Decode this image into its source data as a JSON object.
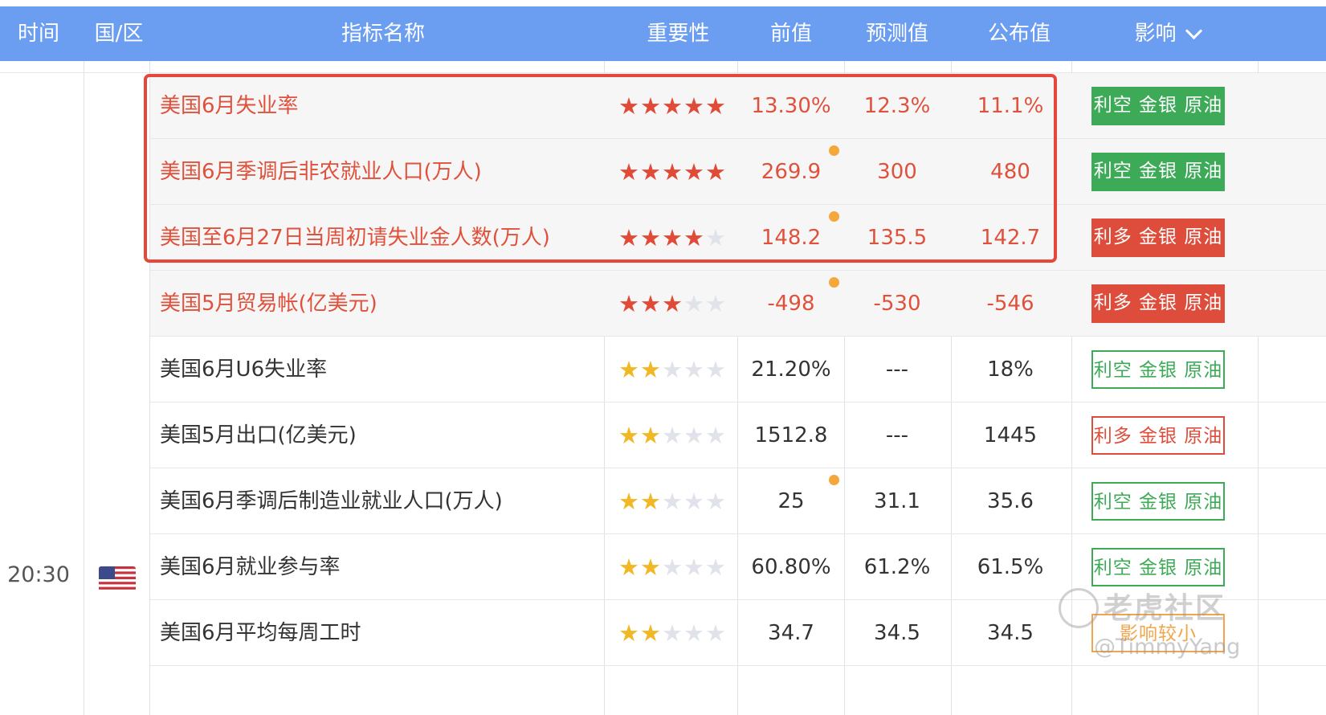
{
  "header": {
    "time": "时间",
    "region": "国/区",
    "indicator": "指标名称",
    "importance": "重要性",
    "previous": "前值",
    "forecast": "预测值",
    "actual": "公布值",
    "impact": "影响"
  },
  "group": {
    "time": "20:30",
    "flag_icon": "us-flag-icon"
  },
  "rows": [
    {
      "name": "美国6月失业率",
      "stars": 5,
      "previous": "13.30%",
      "forecast": "12.3%",
      "actual": "11.1%",
      "impact": "利空 金银 原油",
      "highlight": true,
      "revised": false
    },
    {
      "name": "美国6月季调后非农就业人口(万人)",
      "stars": 5,
      "previous": "269.9",
      "forecast": "300",
      "actual": "480",
      "impact": "利空 金银 原油",
      "highlight": true,
      "revised": true
    },
    {
      "name": "美国至6月27日当周初请失业金人数(万人)",
      "stars": 4,
      "previous": "148.2",
      "forecast": "135.5",
      "actual": "142.7",
      "impact": "利多 金银 原油",
      "highlight": true,
      "revised": true
    },
    {
      "name": "美国5月贸易帐(亿美元)",
      "stars": 3,
      "previous": "-498",
      "forecast": "-530",
      "actual": "-546",
      "impact": "利多 金银 原油",
      "highlight": true,
      "revised": true
    },
    {
      "name": "美国6月U6失业率",
      "stars": 2,
      "previous": "21.20%",
      "forecast": "---",
      "actual": "18%",
      "impact": "利空 金银 原油",
      "highlight": false,
      "revised": false
    },
    {
      "name": "美国5月出口(亿美元)",
      "stars": 2,
      "previous": "1512.8",
      "forecast": "---",
      "actual": "1445",
      "impact": "利多 金银 原油",
      "highlight": false,
      "revised": false
    },
    {
      "name": "美国6月季调后制造业就业人口(万人)",
      "stars": 2,
      "previous": "25",
      "forecast": "31.1",
      "actual": "35.6",
      "impact": "利空 金银 原油",
      "highlight": false,
      "revised": true
    },
    {
      "name": "美国6月就业参与率",
      "stars": 2,
      "previous": "60.80%",
      "forecast": "61.2%",
      "actual": "61.5%",
      "impact": "利空 金银 原油",
      "highlight": false,
      "revised": false
    },
    {
      "name": "美国6月平均每周工时",
      "stars": 2,
      "previous": "34.7",
      "forecast": "34.5",
      "actual": "34.5",
      "impact": "影响较小",
      "highlight": false,
      "revised": false
    }
  ],
  "watermark": {
    "site": "老虎社区",
    "user": "@TimmyYang"
  },
  "colors": {
    "header_bg": "#6b9ef0",
    "bearish_green": "#3daa57",
    "bullish_red": "#de4d3b",
    "neutral_orange": "#f2a54a",
    "highlight_border": "#e5473a",
    "revised_dot": "#f4a73a"
  }
}
